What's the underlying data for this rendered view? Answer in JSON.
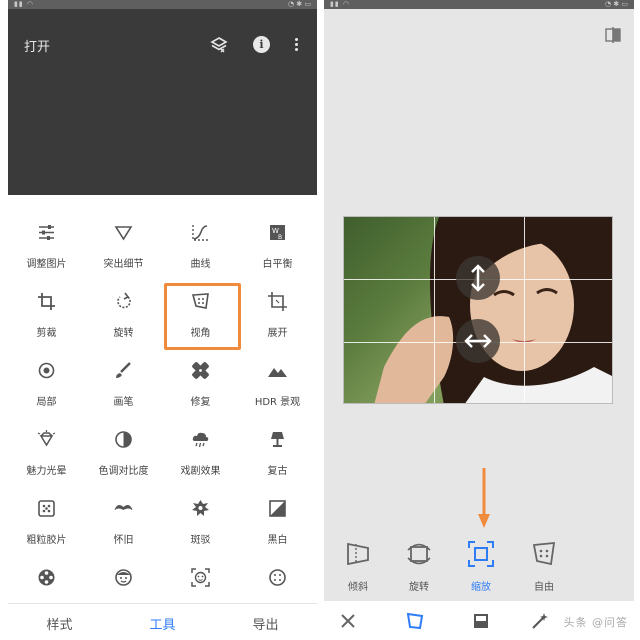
{
  "left_panel": {
    "header": {
      "open_label": "打开"
    },
    "tools": [
      {
        "label": "调整图片",
        "icon": "sliders-icon"
      },
      {
        "label": "突出细节",
        "icon": "triangle-down-icon"
      },
      {
        "label": "曲线",
        "icon": "curves-icon"
      },
      {
        "label": "白平衡",
        "icon": "white-balance-icon"
      },
      {
        "label": "剪裁",
        "icon": "crop-icon"
      },
      {
        "label": "旋转",
        "icon": "rotate-icon"
      },
      {
        "label": "视角",
        "icon": "perspective-icon"
      },
      {
        "label": "展开",
        "icon": "expand-icon"
      },
      {
        "label": "局部",
        "icon": "target-icon"
      },
      {
        "label": "画笔",
        "icon": "brush-icon"
      },
      {
        "label": "修复",
        "icon": "healing-icon"
      },
      {
        "label": "HDR 景观",
        "icon": "mountain-icon"
      },
      {
        "label": "魅力光晕",
        "icon": "diamond-glow-icon"
      },
      {
        "label": "色调对比度",
        "icon": "tonal-contrast-icon"
      },
      {
        "label": "戏剧效果",
        "icon": "cloud-drama-icon"
      },
      {
        "label": "复古",
        "icon": "lamp-icon"
      },
      {
        "label": "粗粒胶片",
        "icon": "grain-icon"
      },
      {
        "label": "怀旧",
        "icon": "mustache-icon"
      },
      {
        "label": "斑驳",
        "icon": "grunge-icon"
      },
      {
        "label": "黑白",
        "icon": "black-white-icon"
      },
      {
        "label": "",
        "icon": "film-reel-icon"
      },
      {
        "label": "",
        "icon": "face-icon"
      },
      {
        "label": "",
        "icon": "face-frame-icon"
      },
      {
        "label": "",
        "icon": "dots-circle-icon"
      }
    ],
    "highlighted_tool": "视角",
    "tabs": [
      {
        "label": "样式",
        "active": false
      },
      {
        "label": "工具",
        "active": true
      },
      {
        "label": "导出",
        "active": false
      }
    ]
  },
  "right_panel": {
    "perspective_tools": [
      {
        "label": "倾斜",
        "icon": "tilt-icon",
        "active": false
      },
      {
        "label": "旋转",
        "icon": "rotate-frame-icon",
        "active": false
      },
      {
        "label": "缩放",
        "icon": "scale-icon",
        "active": true
      },
      {
        "label": "自由",
        "icon": "free-icon",
        "active": false
      }
    ],
    "watermark": "头条 @问答"
  },
  "colors": {
    "accent_blue": "#2f7df6",
    "highlight_orange": "#f08a3c",
    "dark_header": "#3a3a3a",
    "editor_bg": "#e6e6e6"
  }
}
